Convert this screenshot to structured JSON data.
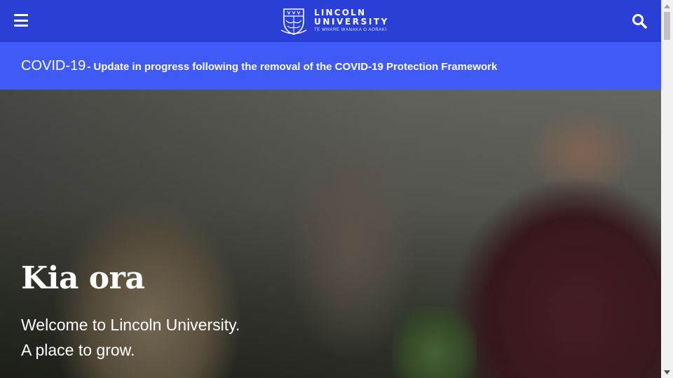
{
  "header": {
    "logo": {
      "line1": "LINCOLN",
      "line2": "UNIVERSITY",
      "tagline": "TE WHARE WĀNAKA O AORAKI"
    },
    "menu_icon": "hamburger-menu-icon",
    "search_icon": "search-icon",
    "background_color": "#2a3fd6"
  },
  "alert": {
    "title": "COVID-19",
    "text": "- Update in progress following the removal of the COVID-19 Protection Framework",
    "background_color": "#3f5af5"
  },
  "hero": {
    "heading": "Kia ora",
    "line1": "Welcome to Lincoln University.",
    "line2": "A place to grow."
  }
}
